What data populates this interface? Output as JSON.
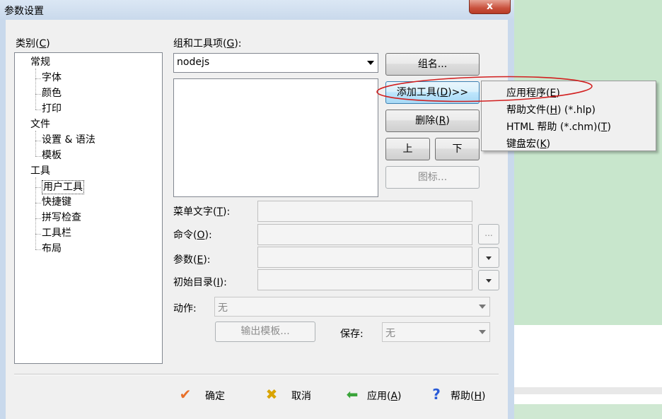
{
  "window": {
    "title": "参数设置",
    "close_glyph": "x"
  },
  "category": {
    "label": "类别",
    "label_key": "C",
    "tree": [
      {
        "label": "常规",
        "level": 0
      },
      {
        "label": "字体",
        "level": 1
      },
      {
        "label": "颜色",
        "level": 1
      },
      {
        "label": "打印",
        "level": 1
      },
      {
        "label": "文件",
        "level": 0
      },
      {
        "label": "设置 & 语法",
        "level": 1
      },
      {
        "label": "模板",
        "level": 1
      },
      {
        "label": "工具",
        "level": 0
      },
      {
        "label": "用户工具",
        "level": 1,
        "selected": true
      },
      {
        "label": "快捷键",
        "level": 1
      },
      {
        "label": "拼写检查",
        "level": 1
      },
      {
        "label": "工具栏",
        "level": 1
      },
      {
        "label": "布局",
        "level": 1
      }
    ]
  },
  "group": {
    "label": "组和工具项",
    "label_key": "G",
    "selected": "nodejs"
  },
  "buttons": {
    "group_name": "组名...",
    "add_tool": "添加工具",
    "add_tool_key": "D",
    "add_tool_suffix": ">>",
    "delete": "删除",
    "delete_key": "R",
    "up": "上",
    "down": "下",
    "icon": "图标...",
    "browse": "...",
    "output_template": "输出模板..."
  },
  "fields": {
    "menu_text": {
      "label": "菜单文字",
      "key": "T"
    },
    "command": {
      "label": "命令",
      "key": "O"
    },
    "args": {
      "label": "参数",
      "key": "E"
    },
    "init_dir": {
      "label": "初始目录",
      "key": "I"
    },
    "action": {
      "label": "动作:",
      "value": "无"
    },
    "save": {
      "label": "保存:",
      "value": "无"
    }
  },
  "menu": [
    {
      "label": "应用程序",
      "key": "E",
      "suffix": ""
    },
    {
      "label": "帮助文件",
      "key": "H",
      "suffix": " (*.hlp)"
    },
    {
      "label": "HTML 帮助 (*.chm)",
      "key": "T",
      "suffix": ""
    },
    {
      "label": "键盘宏",
      "key": "K",
      "suffix": ""
    }
  ],
  "footer": {
    "ok": "确定",
    "cancel": "取消",
    "apply": "应用",
    "apply_key": "A",
    "help": "帮助",
    "help_key": "H"
  },
  "colors": {
    "annotation_circle": "#d21f1f",
    "ok_icon": "#e8702a",
    "cancel_icon": "#d9a400",
    "apply_icon": "#3aa43a",
    "help_icon": "#2a5bd7"
  }
}
